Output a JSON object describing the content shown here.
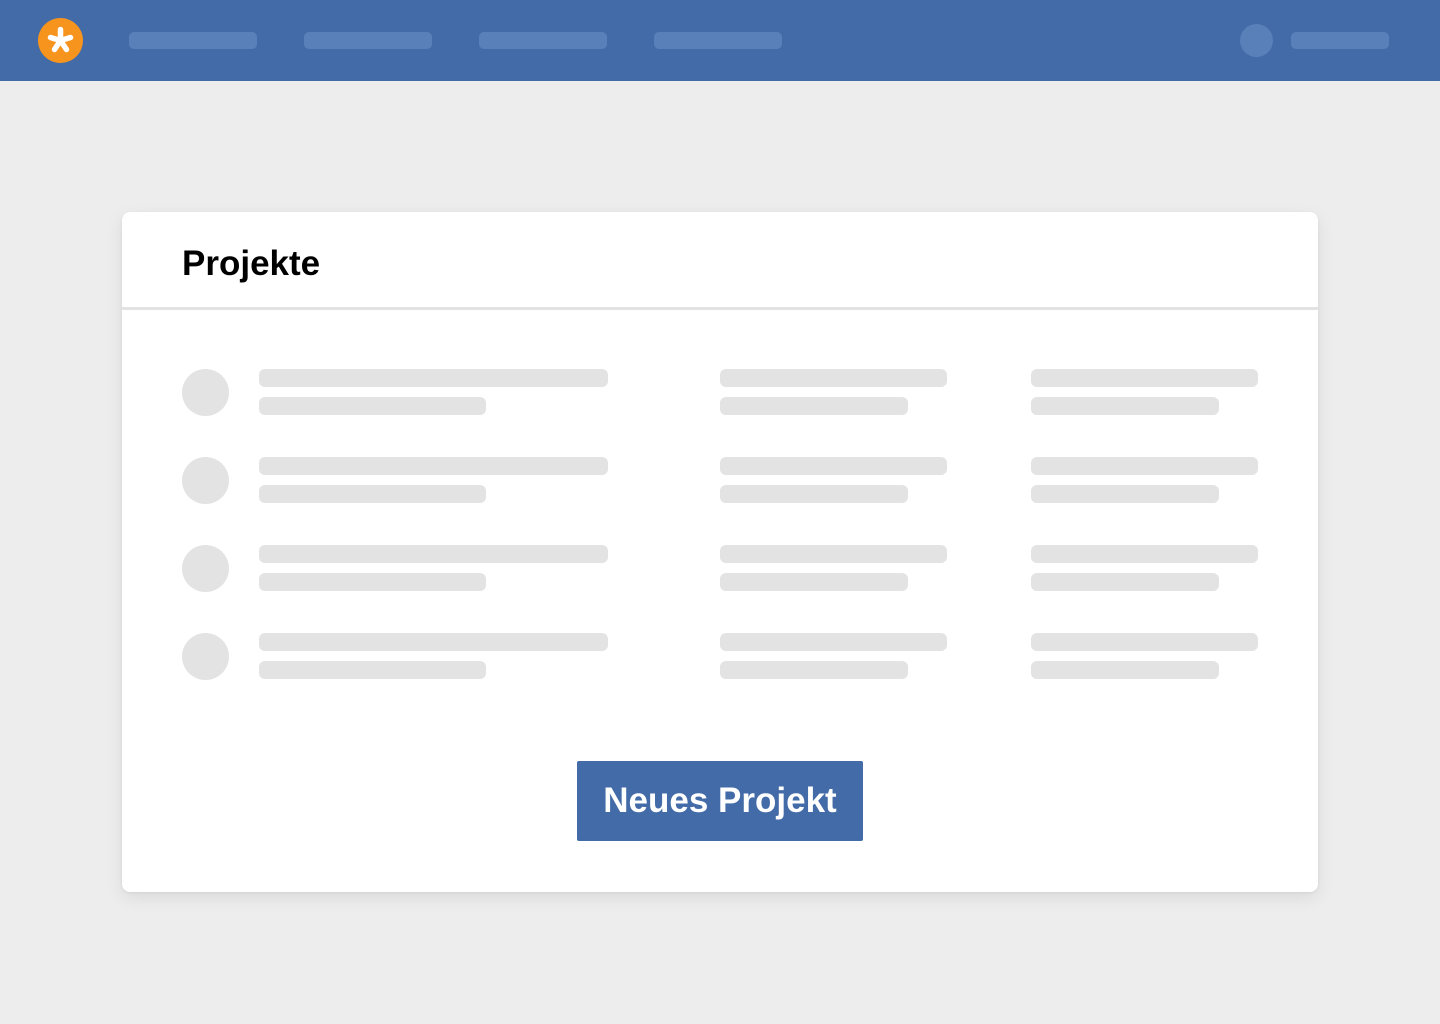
{
  "colors": {
    "page_background": "#ededed",
    "topbar_background": "#436ba8",
    "topbar_placeholder": "#5a80ba",
    "logo_background": "#f7941d",
    "logo_glyph": "#ffffff",
    "skeleton": "#e3e3e3",
    "button_background": "#436ba8"
  },
  "topbar": {
    "logo_icon": "asterisk-icon",
    "nav_items": [
      "",
      "",
      "",
      ""
    ],
    "user_name": ""
  },
  "card": {
    "title": "Projekte",
    "rows": [
      {
        "avatar": "",
        "name": "",
        "subtitle": "",
        "col2_top": "",
        "col2_bottom": "",
        "col3_top": "",
        "col3_bottom": ""
      },
      {
        "avatar": "",
        "name": "",
        "subtitle": "",
        "col2_top": "",
        "col2_bottom": "",
        "col3_top": "",
        "col3_bottom": ""
      },
      {
        "avatar": "",
        "name": "",
        "subtitle": "",
        "col2_top": "",
        "col2_bottom": "",
        "col3_top": "",
        "col3_bottom": ""
      },
      {
        "avatar": "",
        "name": "",
        "subtitle": "",
        "col2_top": "",
        "col2_bottom": "",
        "col3_top": "",
        "col3_bottom": ""
      }
    ],
    "button_label": "Neues Projekt"
  }
}
